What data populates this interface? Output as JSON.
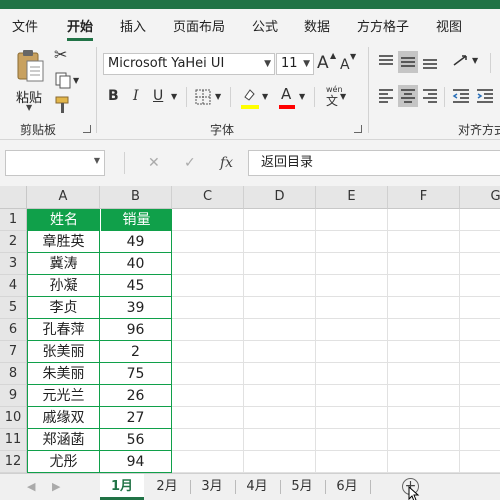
{
  "ribbon_tabs": [
    "文件",
    "开始",
    "插入",
    "页面布局",
    "公式",
    "数据",
    "方方格子",
    "视图"
  ],
  "clipboard": {
    "paste_label": "粘贴",
    "group_label": "剪贴板"
  },
  "font": {
    "name": "Microsoft YaHei UI",
    "size": "11",
    "grow_label": "A",
    "shrink_label": "A",
    "bold": "B",
    "italic": "I",
    "underline": "U",
    "phonetic_label": "wén",
    "group_label": "字体",
    "highlight_color": "#ffff00",
    "font_color": "#ff0000"
  },
  "alignment": {
    "group_label": "对齐方式"
  },
  "formula_bar": {
    "cancel": "✕",
    "enter": "✓",
    "fx": "fx",
    "content": "返回目录"
  },
  "columns": [
    "A",
    "B",
    "C",
    "D",
    "E",
    "F",
    "G"
  ],
  "rows": [
    "1",
    "2",
    "3",
    "4",
    "5",
    "6",
    "7",
    "8",
    "9",
    "10",
    "11",
    "12"
  ],
  "table": {
    "header": [
      "姓名",
      "销量"
    ],
    "rows": [
      [
        "章胜英",
        "49"
      ],
      [
        "冀涛",
        "40"
      ],
      [
        "孙凝",
        "45"
      ],
      [
        "李贞",
        "39"
      ],
      [
        "孔春萍",
        "96"
      ],
      [
        "张美丽",
        "2"
      ],
      [
        "朱美丽",
        "75"
      ],
      [
        "元光兰",
        "26"
      ],
      [
        "戚缘双",
        "27"
      ],
      [
        "郑涵菡",
        "56"
      ],
      [
        "尤彤",
        "94"
      ]
    ],
    "accent_color": "#10a04a"
  },
  "sheet_tabs": [
    "1月",
    "2月",
    "3月",
    "4月",
    "5月",
    "6月"
  ],
  "active_sheet": "1月",
  "add_sheet": "+"
}
